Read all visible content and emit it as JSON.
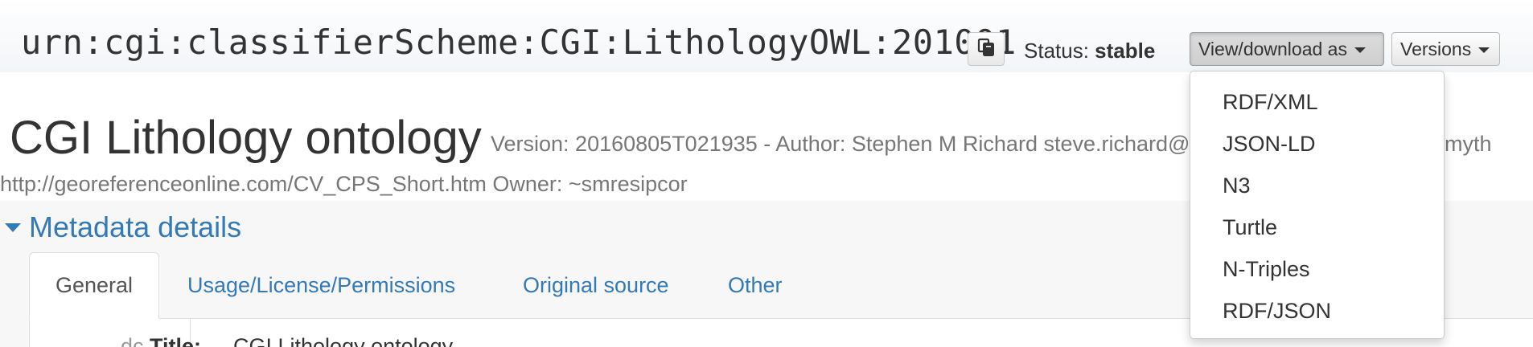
{
  "header": {
    "urn": "urn:cgi:classifierScheme:CGI:LithologyOWL:201001",
    "copy_icon": "copy-icon",
    "status_label": "Status:",
    "status_value": "stable",
    "view_download_label": "View/download as",
    "versions_label": "Versions"
  },
  "view_download_menu": {
    "items": [
      "RDF/XML",
      "JSON-LD",
      "N3",
      "Turtle",
      "N-Triples",
      "RDF/JSON"
    ]
  },
  "title": {
    "name": "CGI Lithology ontology",
    "meta_line": "Version: 20160805T021935 - Author: Stephen M Richard steve.richard@",
    "meta_line_tail": "myth",
    "meta_line2": "http://georeferenceonline.com/CV_CPS_Short.htm Owner: ~smresipcor"
  },
  "metadata": {
    "toggle_label": "Metadata details",
    "tabs": [
      "General",
      "Usage/License/Permissions",
      "Original source",
      "Other"
    ],
    "row": {
      "prefix": "dc",
      "label": "Title:",
      "value": "CGI Lithology ontology"
    }
  },
  "colors": {
    "link": "#337ab7",
    "muted": "#777777",
    "text": "#333333"
  }
}
